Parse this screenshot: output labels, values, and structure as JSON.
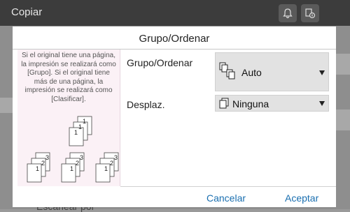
{
  "app": {
    "title": "Copiar",
    "bottom_text": "Escanear por"
  },
  "dialog": {
    "title": "Grupo/Ordenar",
    "description": "Si el original tiene una página, la impresión se realizará como [Grupo]. Si el original tiene más de una página, la impresión se realizará como [Clasificar].",
    "fields": {
      "group_sort": {
        "label": "Grupo/Ordenar",
        "value": "Auto",
        "icon": "group-sort-icon"
      },
      "offset": {
        "label": "Desplaz.",
        "value": "Ninguna",
        "icon": "page-icon"
      }
    },
    "buttons": {
      "cancel": "Cancelar",
      "accept": "Aceptar"
    },
    "illustration": {
      "top_stack": [
        "1",
        "1",
        "1"
      ],
      "bottom_stacks": [
        [
          "1",
          "2",
          "3"
        ],
        [
          "1",
          "2",
          "3"
        ],
        [
          "1",
          "2",
          "3"
        ]
      ]
    }
  },
  "colors": {
    "accent": "#1a6fb0",
    "panel_bg": "#fbf1f6",
    "select_bg": "#e2e2e2"
  }
}
